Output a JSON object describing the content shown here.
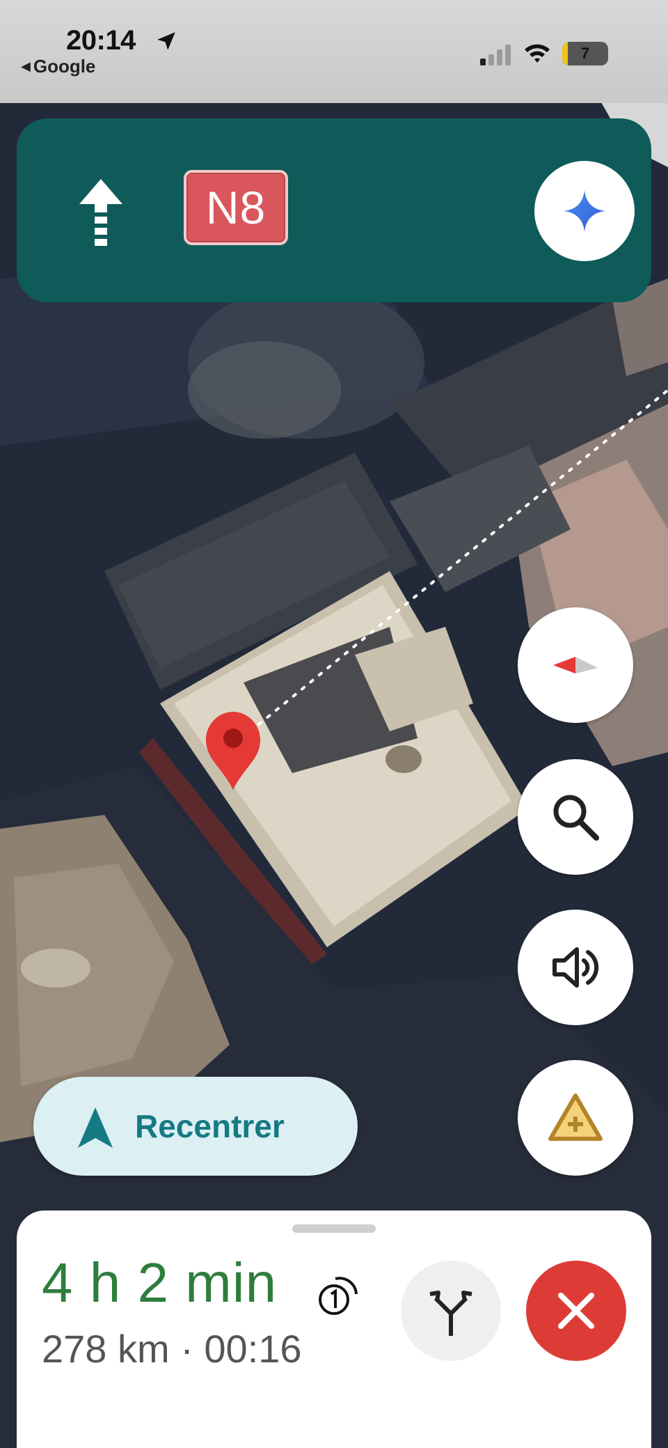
{
  "status_bar": {
    "time": "20:14",
    "back_app": "Google",
    "battery_level": "7",
    "battery_fraction": 0.07,
    "icons": [
      "location-arrow-icon",
      "signal-icon",
      "wifi-icon",
      "battery-icon"
    ]
  },
  "navigation": {
    "direction": "straight",
    "road": "N8",
    "road_badge_color": "#d9575c",
    "banner_color": "#0f5b59",
    "assistant_icon": "gemini-sparkle-icon"
  },
  "map": {
    "destination_marker_color": "#e53935",
    "route_style": "dotted-white"
  },
  "controls": {
    "compass_icon": "compass-icon",
    "search_icon": "search-icon",
    "sound_icon": "volume-icon",
    "report_icon": "report-incident-icon",
    "recenter_label": "Recentrer"
  },
  "trip": {
    "duration": "4 h 2 min",
    "details": "278 km · 00:16",
    "duration_color": "#2e7d3c",
    "alternates_icon": "route-alternates-icon",
    "exit_icon": "close-icon",
    "exit_color": "#dd3b35"
  }
}
